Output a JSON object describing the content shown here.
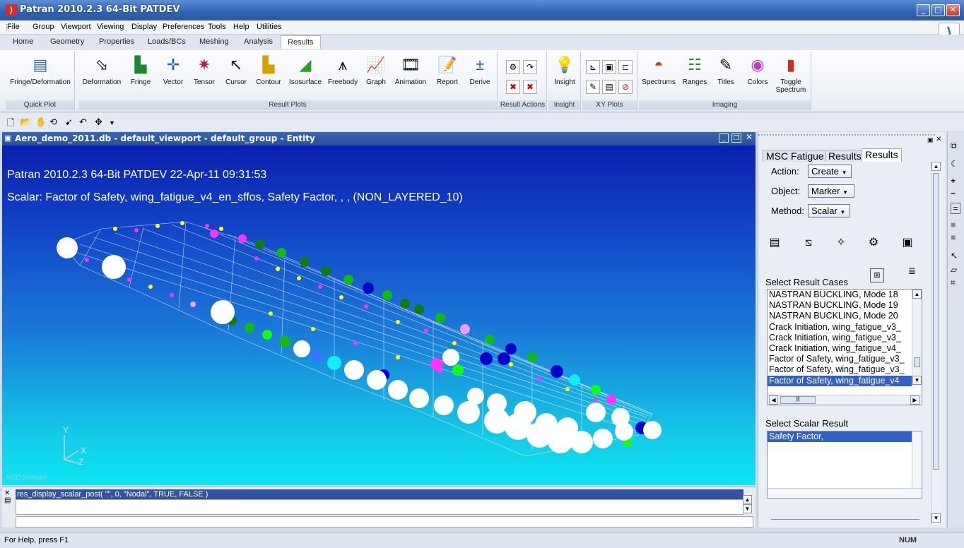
{
  "window": {
    "title": "Patran 2010.2.3 64-Bit PATDEV"
  },
  "menu": [
    "File",
    "Group",
    "Viewport",
    "Viewing",
    "Display",
    "Preferences",
    "Tools",
    "Help",
    "Utilities"
  ],
  "tabs": [
    "Home",
    "Geometry",
    "Properties",
    "Loads/BCs",
    "Meshing",
    "Analysis",
    "Results"
  ],
  "ribbon": {
    "quick_plot": {
      "label": "Quick Plot",
      "button": "Fringe/Deformation"
    },
    "result_plots": {
      "label": "Result Plots",
      "buttons": [
        "Deformation",
        "Fringe",
        "Vector",
        "Tensor",
        "Cursor",
        "Contour",
        "Isosurface",
        "Freebody",
        "Graph",
        "Animation",
        "Report",
        "Derive"
      ]
    },
    "result_actions": {
      "label": "Result Actions"
    },
    "insight": {
      "label": "Insight",
      "button": "Insight"
    },
    "xy_plots": {
      "label": "XY Plots"
    },
    "imaging": {
      "label": "Imaging",
      "buttons": [
        "Spectrums",
        "Ranges",
        "Titles",
        "Colors",
        "Toggle Spectrum"
      ]
    }
  },
  "viewport": {
    "title": "Aero_demo_2011.db - default_viewport - default_group - Entity",
    "header_line1": "Patran 2010.2.3 64-Bit PATDEV 22-Apr-11 09:31:53",
    "header_line2": "Scalar: Factor of Safety, wing_fatigue_v4_en_sffos, Safety Factor, , , (NON_LAYERED_10)",
    "axis_y": "Y",
    "axis_x": "X",
    "axis_z": "Z",
    "watermark": "MSC Software"
  },
  "command": {
    "history": "res_display_scalar_post( \"\", 0, \"Nodal\", TRUE, FALSE )"
  },
  "panel": {
    "tabs": [
      "MSC Fatigue",
      "Results",
      "Results"
    ],
    "action_label": "Action:",
    "action_value": "Create",
    "object_label": "Object:",
    "object_value": "Marker",
    "method_label": "Method:",
    "method_value": "Scalar",
    "select_cases_label": "Select Result Cases",
    "result_cases": [
      "NASTRAN BUCKLING, Mode 18",
      "NASTRAN BUCKLING, Mode 19",
      "NASTRAN BUCKLING, Mode 20",
      "Crack Initiation, wing_fatigue_v3_",
      "Crack Initiation, wing_fatigue_v3_",
      "Crack Initiation, wing_fatigue_v4_",
      "Factor of Safety, wing_fatigue_v3_",
      "Factor of Safety, wing_fatigue_v3_",
      "Factor of Safety, wing_fatigue_v4"
    ],
    "selected_case_index": 8,
    "select_scalar_label": "Select Scalar Result",
    "scalar_results": [
      "Safety Factor,"
    ]
  },
  "status": {
    "help": "For Help, press F1",
    "num": "NUM"
  }
}
